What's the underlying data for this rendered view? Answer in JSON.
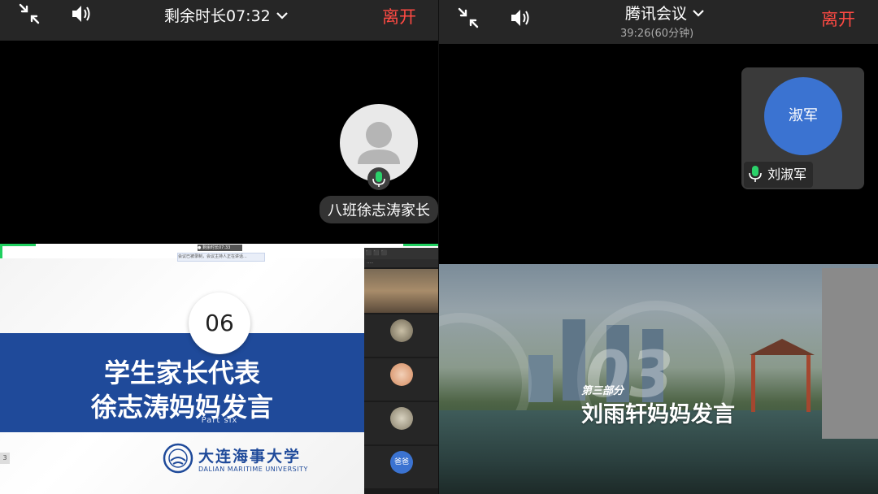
{
  "left_screen": {
    "timer_title": "剩余时长07:32",
    "leave_label": "离开",
    "participant": {
      "name": "八班徐志涛家长"
    },
    "shared_slide": {
      "number": "06",
      "title_line1": "学生家长代表",
      "title_line2": "徐志涛妈妈发言",
      "subtitle_en": "Part six",
      "university_cn": "大连海事大学",
      "university_en": "DALIAN MARITIME UNIVERSITY",
      "side_panel_tile_label": "爸爸",
      "page_edge_number": "3"
    }
  },
  "right_screen": {
    "app_title": "腾讯会议",
    "duration": "39:26(60分钟)",
    "leave_label": "离开",
    "participant": {
      "avatar_text": "淑军",
      "name": "刘淑军"
    },
    "shared_slide": {
      "big_number": "03",
      "part_label": "第三部分",
      "speech_title": "刘雨轩妈妈发言"
    }
  },
  "colors": {
    "leave": "#ff4a43",
    "avatar_blue": "#3b73d1",
    "slide_blue": "#1f4a9a",
    "mic_green": "#2bd16a"
  },
  "icons": [
    "exit-fullscreen-icon",
    "speaker-icon",
    "chevron-down-icon",
    "microphone-icon",
    "default-avatar-icon",
    "university-logo-icon"
  ]
}
